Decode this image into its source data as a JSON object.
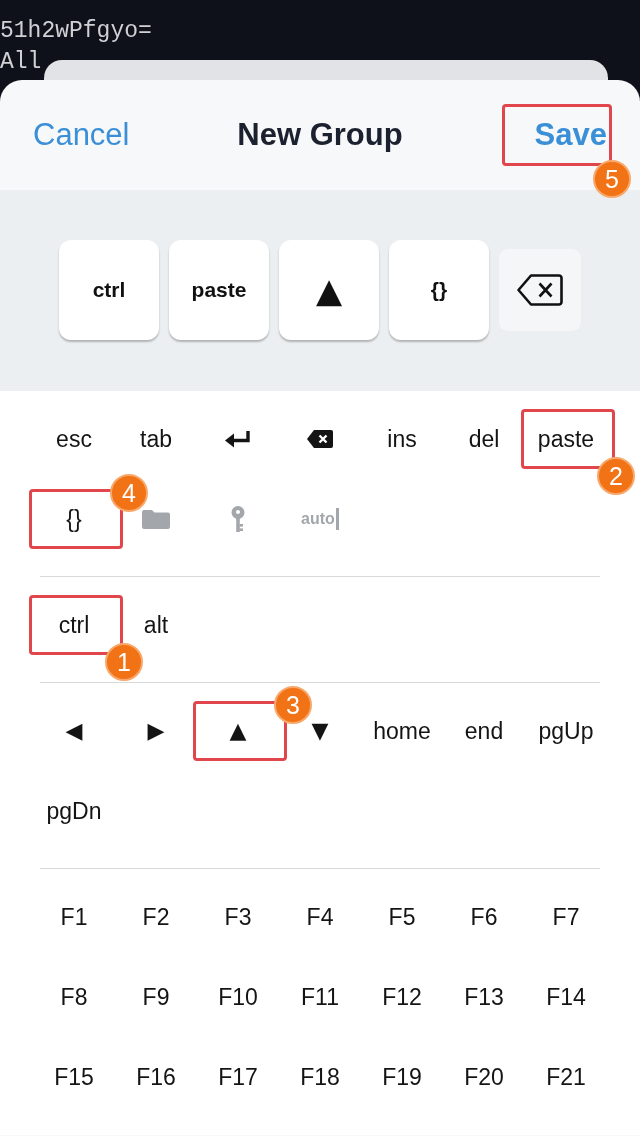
{
  "terminal": {
    "lines": [
      "51h2wPfgyo=",
      "All"
    ]
  },
  "header": {
    "cancel_button": "Cancel",
    "title": "New Group",
    "save_button": {
      "label": "Save",
      "callout": {
        "number": "5",
        "badge_top": false
      }
    }
  },
  "toolbar": {
    "keys": [
      {
        "kind": "text",
        "label": "ctrl"
      },
      {
        "kind": "text",
        "label": "paste"
      },
      {
        "kind": "glyph",
        "label": "▲"
      },
      {
        "kind": "text",
        "label": "{}"
      },
      {
        "kind": "erase"
      }
    ]
  },
  "keyboard": {
    "groups": [
      {
        "keys": [
          {
            "kind": "text",
            "label": "esc",
            "disabled": false
          },
          {
            "kind": "text",
            "label": "tab",
            "disabled": false
          },
          {
            "kind": "return",
            "disabled": false
          },
          {
            "kind": "erase",
            "disabled": false
          },
          {
            "kind": "text",
            "label": "ins",
            "disabled": false
          },
          {
            "kind": "text",
            "label": "del",
            "disabled": false
          },
          {
            "kind": "text",
            "label": "paste",
            "disabled": false,
            "callout": {
              "number": "2",
              "badge_top": false
            }
          },
          {
            "kind": "text",
            "label": "{}",
            "disabled": false,
            "callout": {
              "number": "4",
              "badge_top": true
            }
          },
          {
            "kind": "folder",
            "disabled": true
          },
          {
            "kind": "key",
            "disabled": true
          },
          {
            "kind": "caret",
            "label": "auto",
            "disabled": true
          }
        ]
      },
      {
        "keys": [
          {
            "kind": "text",
            "label": "ctrl",
            "disabled": false,
            "callout": {
              "number": "1",
              "badge_top": false
            }
          },
          {
            "kind": "text",
            "label": "alt",
            "disabled": false
          }
        ]
      },
      {
        "keys": [
          {
            "kind": "glyph",
            "label": "◀",
            "disabled": false
          },
          {
            "kind": "glyph",
            "label": "▶",
            "disabled": false
          },
          {
            "kind": "glyph",
            "label": "▲",
            "disabled": false,
            "callout": {
              "number": "3",
              "badge_top": true
            }
          },
          {
            "kind": "glyph",
            "label": "▼",
            "disabled": false
          },
          {
            "kind": "text",
            "label": "home",
            "disabled": false
          },
          {
            "kind": "text",
            "label": "end",
            "disabled": false
          },
          {
            "kind": "text",
            "label": "pgUp",
            "disabled": false
          },
          {
            "kind": "text",
            "label": "pgDn",
            "disabled": false
          }
        ]
      },
      {
        "keys": [
          {
            "kind": "text",
            "label": "F1",
            "disabled": false
          },
          {
            "kind": "text",
            "label": "F2",
            "disabled": false
          },
          {
            "kind": "text",
            "label": "F3",
            "disabled": false
          },
          {
            "kind": "text",
            "label": "F4",
            "disabled": false
          },
          {
            "kind": "text",
            "label": "F5",
            "disabled": false
          },
          {
            "kind": "text",
            "label": "F6",
            "disabled": false
          },
          {
            "kind": "text",
            "label": "F7",
            "disabled": false
          },
          {
            "kind": "text",
            "label": "F8",
            "disabled": false
          },
          {
            "kind": "text",
            "label": "F9",
            "disabled": false
          },
          {
            "kind": "text",
            "label": "F10",
            "disabled": false
          },
          {
            "kind": "text",
            "label": "F11",
            "disabled": false
          },
          {
            "kind": "text",
            "label": "F12",
            "disabled": false
          },
          {
            "kind": "text",
            "label": "F13",
            "disabled": false
          },
          {
            "kind": "text",
            "label": "F14",
            "disabled": false
          },
          {
            "kind": "text",
            "label": "F15",
            "disabled": false
          },
          {
            "kind": "text",
            "label": "F16",
            "disabled": false
          },
          {
            "kind": "text",
            "label": "F17",
            "disabled": false
          },
          {
            "kind": "text",
            "label": "F18",
            "disabled": false
          },
          {
            "kind": "text",
            "label": "F19",
            "disabled": false
          },
          {
            "kind": "text",
            "label": "F20",
            "disabled": false
          },
          {
            "kind": "text",
            "label": "F21",
            "disabled": false
          }
        ]
      }
    ]
  }
}
